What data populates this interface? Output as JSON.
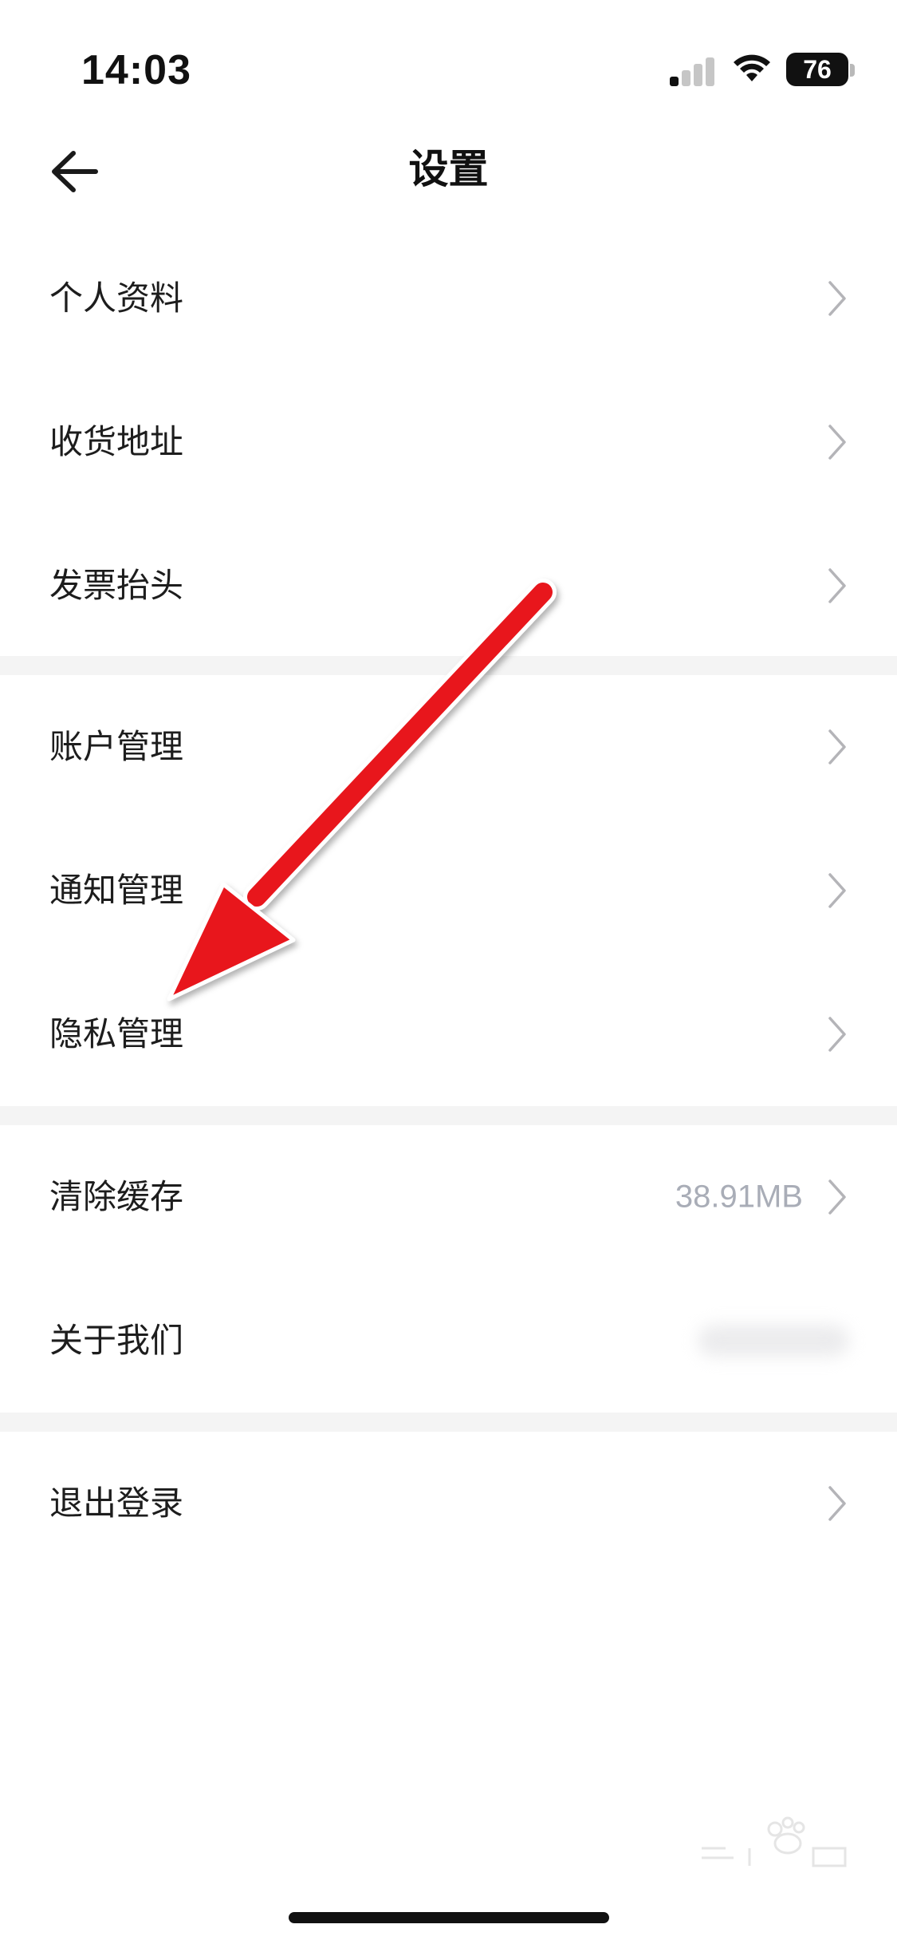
{
  "status_bar": {
    "time": "14:03",
    "battery": "76",
    "signal_icon": "cellular-signal-icon",
    "wifi_icon": "wifi-icon"
  },
  "nav": {
    "title": "设置",
    "back_icon": "back-arrow-icon"
  },
  "groups": [
    {
      "items": [
        {
          "label": "个人资料",
          "value": ""
        },
        {
          "label": "收货地址",
          "value": ""
        },
        {
          "label": "发票抬头",
          "value": ""
        }
      ]
    },
    {
      "items": [
        {
          "label": "账户管理",
          "value": ""
        },
        {
          "label": "通知管理",
          "value": ""
        },
        {
          "label": "隐私管理",
          "value": ""
        }
      ]
    },
    {
      "items": [
        {
          "label": "清除缓存",
          "value": "38.91MB"
        },
        {
          "label": "关于我们",
          "value": ""
        }
      ]
    },
    {
      "items": [
        {
          "label": "退出登录",
          "value": ""
        }
      ]
    }
  ],
  "colors": {
    "annotation_arrow": "#e8141e",
    "divider": "#f4f4f4",
    "chevron": "#b4b4b8",
    "secondary_text": "#a9adb7"
  }
}
